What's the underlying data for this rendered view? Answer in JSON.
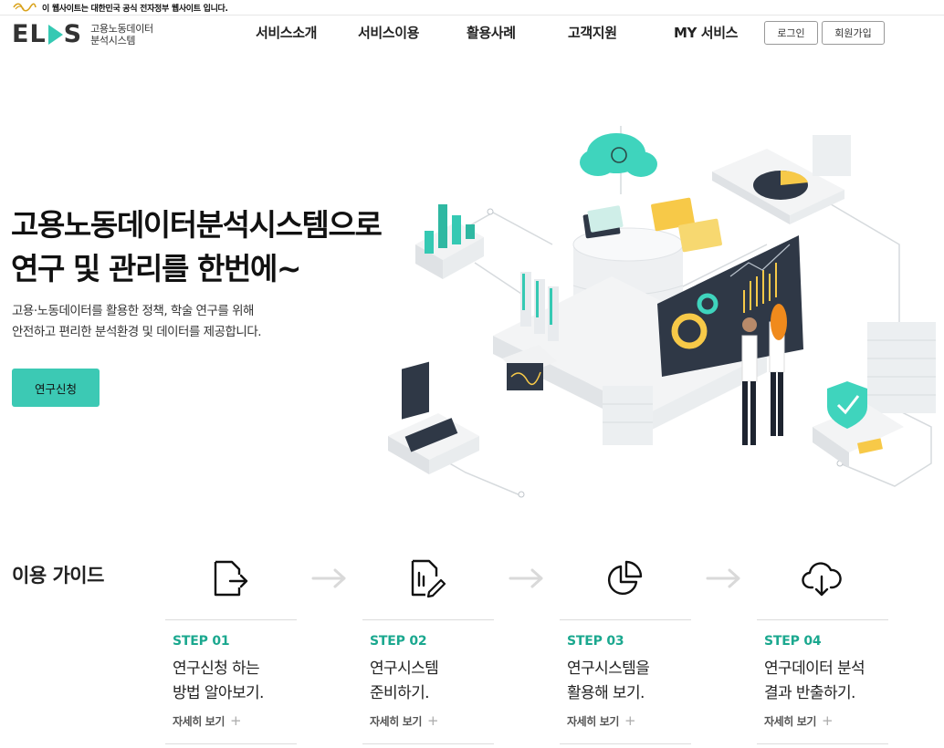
{
  "gov_banner": {
    "text": "이 웹사이트는 대한민국 공식 전자정부 웹사이트 입니다."
  },
  "logo": {
    "mark_left": "EL",
    "mark_right": "S",
    "sub_line1": "고용노동데이터",
    "sub_line2": "분석시스템"
  },
  "nav": {
    "items": [
      {
        "label": "서비스소개"
      },
      {
        "label": "서비스이용"
      },
      {
        "label": "활용사례"
      },
      {
        "label": "고객지원"
      },
      {
        "label": "MY 서비스"
      }
    ],
    "login_label": "로그인",
    "signup_label": "회원가입"
  },
  "hero": {
    "title_line1": "고용노동데이터분석시스템으로",
    "title_line2": "연구 및 관리를 한번에~",
    "desc_line1": "고용·노동데이터를 활용한 정책, 학술 연구를 위해",
    "desc_line2": "안전하고 편리한 분석환경 및 데이터를 제공합니다.",
    "cta_label": "연구신청"
  },
  "guide": {
    "title": "이용 가이드",
    "steps": [
      {
        "label": "STEP 01",
        "desc_line1": "연구신청 하는",
        "desc_line2": "방법 알아보기.",
        "link": "자세히 보기",
        "icon": "document-export-icon"
      },
      {
        "label": "STEP 02",
        "desc_line1": "연구시스템",
        "desc_line2": "준비하기.",
        "link": "자세히 보기",
        "icon": "document-edit-icon"
      },
      {
        "label": "STEP 03",
        "desc_line1": "연구시스템을",
        "desc_line2": "활용해 보기.",
        "link": "자세히 보기",
        "icon": "pie-chart-icon"
      },
      {
        "label": "STEP 04",
        "desc_line1": "연구데이터 분석",
        "desc_line2": "결과 반출하기.",
        "link": "자세히 보기",
        "icon": "cloud-download-icon"
      }
    ]
  },
  "colors": {
    "accent": "#3cc9b4",
    "step_label": "#1ba88f",
    "navy": "#2f3846",
    "yellow": "#f7c948"
  }
}
